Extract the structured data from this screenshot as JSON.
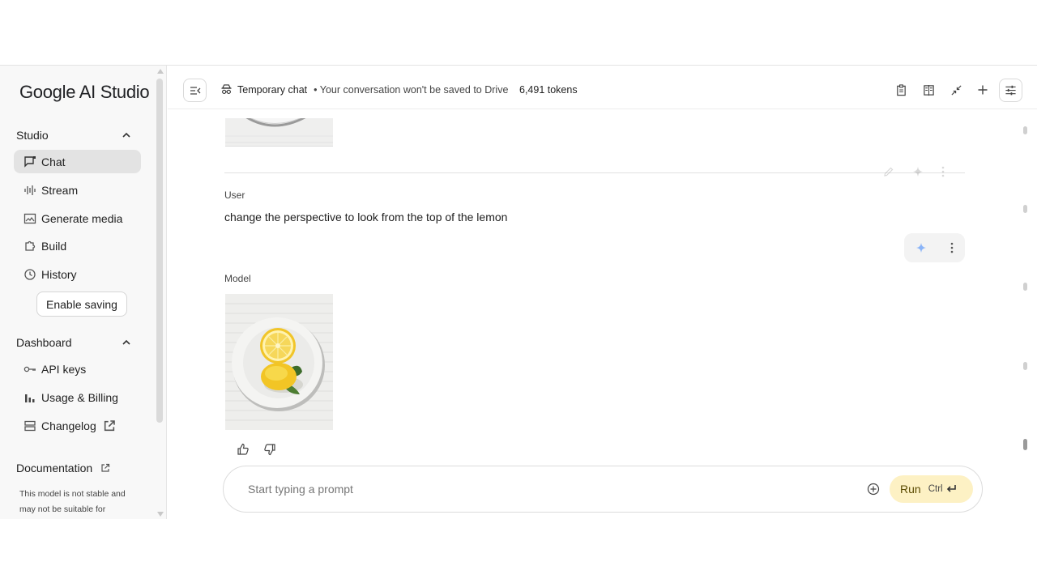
{
  "sidebar": {
    "logo": "Google AI Studio",
    "studio_section": "Studio",
    "studio_items": [
      {
        "label": "Chat",
        "icon": "chat-icon"
      },
      {
        "label": "Stream",
        "icon": "waveform-icon"
      },
      {
        "label": "Generate media",
        "icon": "image-icon"
      },
      {
        "label": "Build",
        "icon": "puzzle-icon"
      },
      {
        "label": "History",
        "icon": "history-icon"
      }
    ],
    "enable_saving": "Enable saving",
    "dashboard_section": "Dashboard",
    "dashboard_items": [
      {
        "label": "API keys",
        "icon": "key-icon"
      },
      {
        "label": "Usage & Billing",
        "icon": "bar-chart-icon"
      },
      {
        "label": "Changelog",
        "icon": "list-icon"
      }
    ],
    "documentation": "Documentation",
    "note": "This model is not stable and may not be suitable for"
  },
  "topbar": {
    "temp_chat": "Temporary chat",
    "temp_note": "• Your conversation won't be saved to Drive",
    "tokens": "6,491 tokens"
  },
  "chat": {
    "user_role": "User",
    "user_message": "change the perspective to look from the top of the lemon",
    "model_role": "Model"
  },
  "prompt": {
    "placeholder": "Start typing a prompt",
    "run_label": "Run",
    "shortcut": "Ctrl"
  },
  "colors": {
    "accent_run": "#fdf1c4",
    "active_nav": "#e3e3e3",
    "sparkle": "#8ab4f8"
  }
}
